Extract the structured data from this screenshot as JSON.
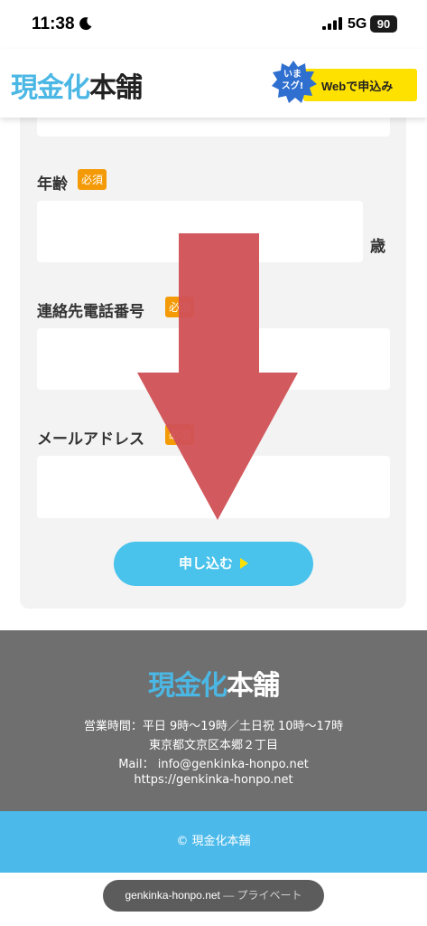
{
  "status": {
    "time": "11:38",
    "network": "5G",
    "battery": "90"
  },
  "header": {
    "logo_part1": "現金化",
    "logo_part2": "本舗",
    "cta_burst": "いま\nスグ!",
    "cta_label": "Webで申込み"
  },
  "form": {
    "required_badge": "必須",
    "fields": [
      {
        "label": "年齢",
        "unit": "歳",
        "value": ""
      },
      {
        "label": "連絡先電話番号",
        "value": ""
      },
      {
        "label": "メールアドレス",
        "value": ""
      }
    ],
    "submit_label": "申し込む"
  },
  "footer": {
    "logo_part1": "現金化",
    "logo_part2": "本舗",
    "hours": "営業時間：平日 9時〜19時／土日祝 10時〜17時",
    "address": "東京都文京区本郷２丁目",
    "mail": "Mail： info@genkinka-honpo.net",
    "url": "https://genkinka-honpo.net",
    "copyright": "© 現金化本舗"
  },
  "browser": {
    "domain": "genkinka-honpo.net",
    "suffix": " — プライベート"
  },
  "colors": {
    "brand_blue": "#4bb7e4",
    "cta_yellow": "#ffe100",
    "required_orange": "#f49a06",
    "button_blue": "#49c3ec",
    "arrow_red": "#d05257",
    "footer_gray": "#6f6f6f"
  }
}
